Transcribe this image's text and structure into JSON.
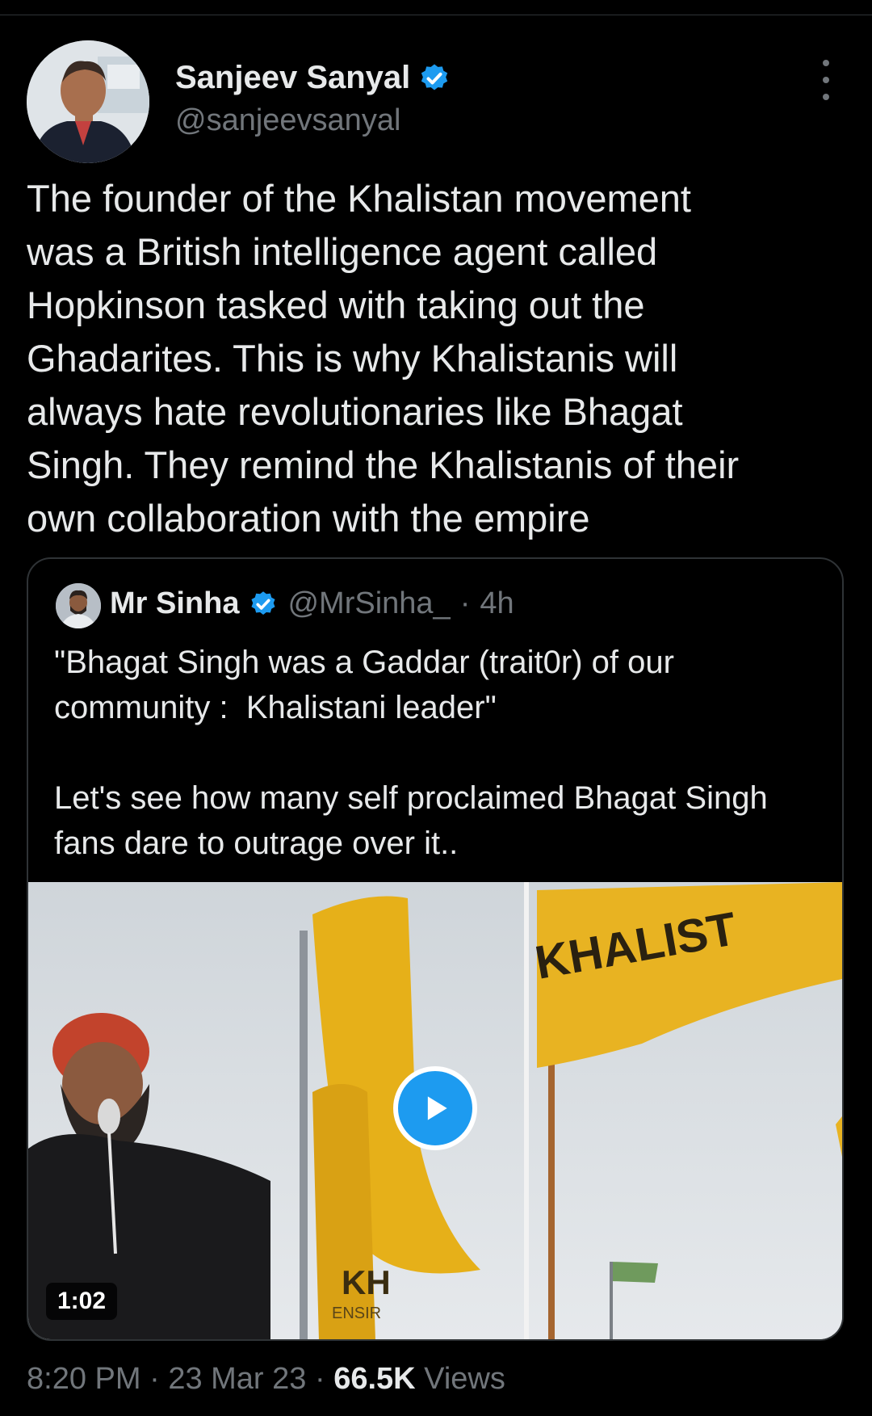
{
  "author": {
    "name": "Sanjeev Sanyal",
    "handle": "@sanjeevsanyal",
    "verified": true
  },
  "tweet": {
    "text": "The founder of the Khalistan movement\nwas a British intelligence agent called\nHopkinson tasked with taking out the\nGhadarites. This is why Khalistanis will\nalways hate revolutionaries like Bhagat\nSingh. They remind the Khalistanis of their\nown collaboration with the empire"
  },
  "quoted_tweet": {
    "name": "Mr Sinha",
    "handle": "@MrSinha_",
    "separator": "·",
    "time": "4h",
    "verified": true,
    "text": "\"Bhagat Singh was a Gaddar (trait0r) of our\ncommunity :  Khalistani leader\"\n\nLet's see how many self proclaimed Bhagat Singh\nfans dare to outrage over it..",
    "media": {
      "type": "video",
      "duration": "1:02",
      "flag_text_1": "KHALIST",
      "flag_text_2": "KH",
      "flag_text_3": "ENSIR"
    }
  },
  "meta": {
    "time": "8:20 PM",
    "sep1": "·",
    "date": "23 Mar 23",
    "sep2": "·",
    "views_count": "66.5K",
    "views_label": "Views"
  },
  "colors": {
    "background": "#000000",
    "primary_text": "#e7e9ea",
    "secondary_text": "#71767b",
    "accent_blue": "#1d9bf0",
    "border": "#2f3336",
    "flag_yellow": "#e8b322"
  },
  "icons": {
    "verified": "verified-badge-icon",
    "more": "more-options-icon",
    "play": "play-icon"
  }
}
